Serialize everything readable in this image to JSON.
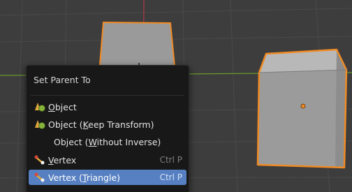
{
  "menu": {
    "title": "Set Parent To",
    "items": [
      {
        "label": "Object",
        "mnemonic": "O",
        "shortcut": "",
        "icon": "object-parent-icon",
        "active": false
      },
      {
        "label": "Object (Keep Transform)",
        "mnemonic": "K",
        "shortcut": "",
        "icon": "object-parent-icon",
        "active": false
      },
      {
        "label": "Object (Without Inverse)",
        "mnemonic": "W",
        "shortcut": "",
        "icon": "",
        "active": false
      },
      {
        "label": "Vertex",
        "mnemonic": "V",
        "shortcut": "Ctrl P",
        "icon": "vertex-parent-icon",
        "active": false
      },
      {
        "label": "Vertex (Triangle)",
        "mnemonic": "T",
        "shortcut": "Ctrl P",
        "icon": "vertex-parent-icon",
        "active": true
      }
    ]
  },
  "colors": {
    "viewport_bg": "#3d3d3d",
    "grid_line": "#4a4a4a",
    "x_axis": "#b03a48",
    "y_axis": "#6a9b2c",
    "selection_outline": "#f08a24",
    "menu_bg": "#181818",
    "menu_highlight": "#5680c2"
  }
}
